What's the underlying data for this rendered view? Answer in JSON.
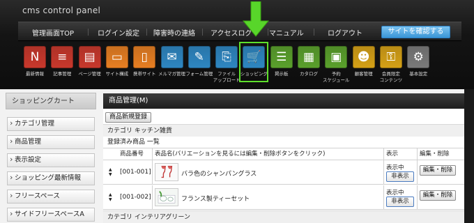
{
  "brand": "cms control panel",
  "topnav": {
    "items": [
      "管理画面TOP",
      "ログイン設定",
      "障害時の連絡",
      "アクセスログ",
      "マニュアル",
      "ログアウト"
    ],
    "site_button": "サイトを確認する"
  },
  "icons": [
    {
      "label": "最新情報",
      "icon": "news-icon",
      "color": "#c8382c"
    },
    {
      "label": "記事管理",
      "icon": "articles-icon",
      "color": "#c8382c"
    },
    {
      "label": "ページ管理",
      "icon": "pages-icon",
      "color": "#c8382c"
    },
    {
      "label": "サイト構成",
      "icon": "site-structure-icon",
      "color": "#e67e22"
    },
    {
      "label": "携帯サイト",
      "icon": "mobile-site-icon",
      "color": "#e67e22"
    },
    {
      "label": "メルマガ管理",
      "icon": "newsletter-icon",
      "color": "#2e86c1"
    },
    {
      "label": "フォーム管理",
      "icon": "form-icon",
      "color": "#2e86c1"
    },
    {
      "label": "ファイル\nアップロード",
      "icon": "file-upload-icon",
      "color": "#2e86c1"
    },
    {
      "label": "ショッピング",
      "icon": "shopping-cart-icon",
      "color": "#2e86c1"
    },
    {
      "label": "掲示板",
      "icon": "bbs-icon",
      "color": "#5aa02c"
    },
    {
      "label": "カタログ",
      "icon": "catalog-icon",
      "color": "#5aa02c"
    },
    {
      "label": "予約\nスケジュール",
      "icon": "schedule-icon",
      "color": "#5aa02c"
    },
    {
      "label": "顧客管理",
      "icon": "customers-icon",
      "color": "#d4a017"
    },
    {
      "label": "会員限定\nコンテンツ",
      "icon": "members-icon",
      "color": "#d4a017"
    },
    {
      "label": "基本設定",
      "icon": "settings-icon",
      "color": "#7a7a7a"
    }
  ],
  "sidebar": {
    "title": "ショッピングカート",
    "items": [
      "カテゴリ管理",
      "商品管理",
      "表示設定",
      "ショッピング最新情報",
      "フリースペース",
      "サイドフリースペースA"
    ]
  },
  "main": {
    "title": "商品管理(M)",
    "new_button": "商品新規登録",
    "category1": "カテゴリ  キッチン雑貨",
    "registered": "登録済み商品  一覧",
    "columns": {
      "code": "商品番号",
      "name": "表品名(バリエーションを見るには編集・削除ボタンをクリック)",
      "display": "表示",
      "edit": "編集・削除"
    },
    "rows": [
      {
        "code": "[001-001]",
        "name": "バラ色のシャンパングラス",
        "status": "表示中",
        "hide": "非表示",
        "edit": "編集・削除"
      },
      {
        "code": "[001-002]",
        "name": "フランス製ティーセット",
        "status": "表示中",
        "hide": "非表示",
        "edit": "編集・削除"
      }
    ],
    "category2": "カテゴリ  インテリアグリーン"
  }
}
